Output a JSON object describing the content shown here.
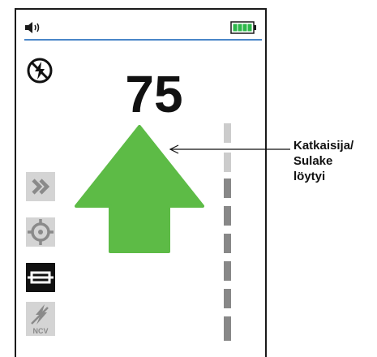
{
  "status_bar": {
    "speaker_icon": "speaker-volume-icon",
    "battery_icon": "battery-full-icon",
    "battery_color": "#2db84a",
    "divider_color": "#4a86c8"
  },
  "indicator": {
    "no_power_icon": "no-power-icon",
    "reading": "75"
  },
  "direction_arrow": {
    "icon": "up-arrow-icon",
    "color": "#5dbb46"
  },
  "side_buttons": [
    {
      "icon": "fast-forward-icon",
      "active": false
    },
    {
      "icon": "target-crosshair-icon",
      "active": false
    },
    {
      "icon": "fuse-icon",
      "active": true
    },
    {
      "icon": "ncv-icon",
      "label": "NCV",
      "active": false
    }
  ],
  "signal_meter": {
    "segments_light": 2,
    "segments_dark": 6,
    "light_color": "#cccccc",
    "dark_color": "#888888"
  },
  "callout": {
    "lines": [
      "Katkaisija/",
      "Sulake",
      "löytyi"
    ]
  }
}
